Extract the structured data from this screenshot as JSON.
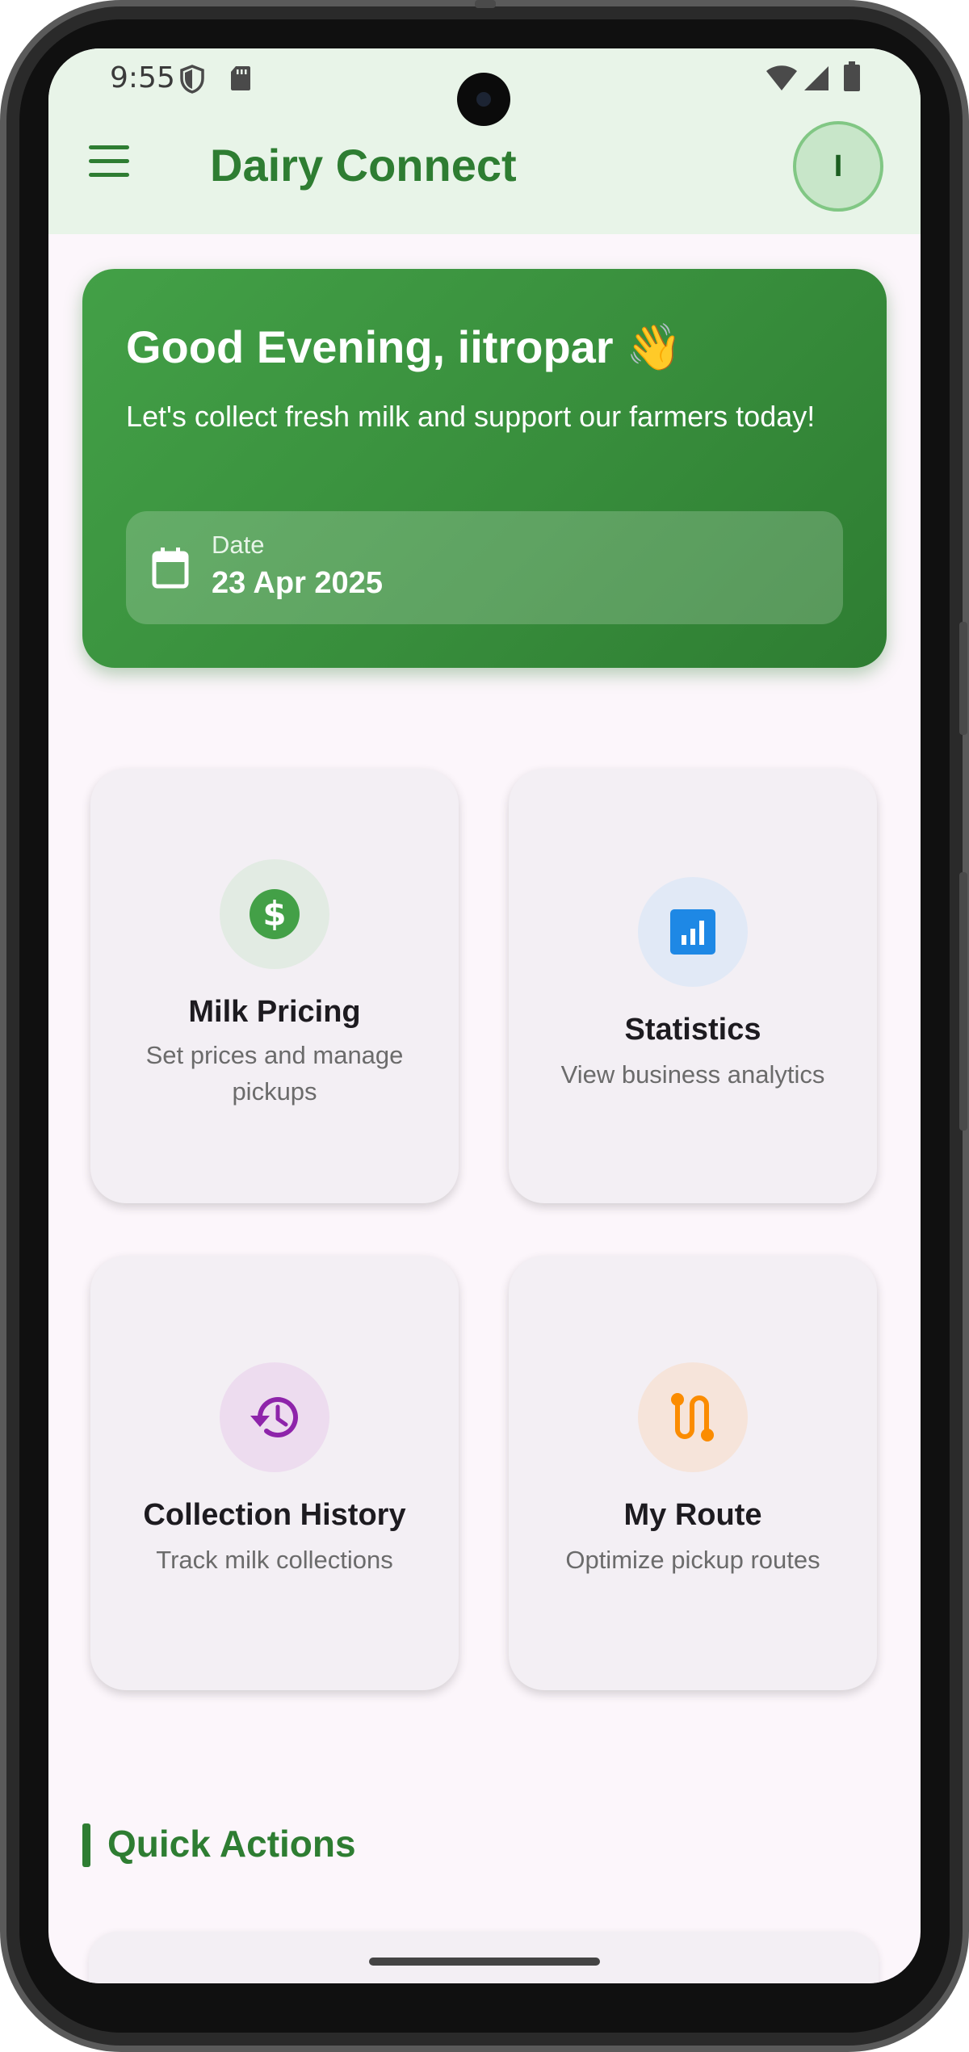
{
  "status_bar": {
    "time": "9:55"
  },
  "header": {
    "title": "Dairy Connect",
    "avatar_initial": "I"
  },
  "greeting": {
    "title": "Good Evening, iitropar 👋",
    "subtitle": "Let's collect fresh milk and support our farmers today!",
    "date_label": "Date",
    "date_value": "23 Apr 2025"
  },
  "tiles": [
    {
      "title": "Milk Pricing",
      "description": "Set prices and manage pickups",
      "icon": "dollar-icon",
      "accent": "#43a047"
    },
    {
      "title": "Statistics",
      "description": "View business analytics",
      "icon": "chart-icon",
      "accent": "#1e88e5"
    },
    {
      "title": "Collection History",
      "description": "Track milk collections",
      "icon": "history-icon",
      "accent": "#8e24aa"
    },
    {
      "title": "My Route",
      "description": "Optimize pickup routes",
      "icon": "route-icon",
      "accent": "#fb8c00"
    }
  ],
  "quick_actions": {
    "title": "Quick Actions"
  },
  "colors": {
    "primary": "#2e7d32",
    "header_bg": "#e8f4e8",
    "screen_bg": "#fcf6fb",
    "tile_bg": "#f3eff4"
  }
}
